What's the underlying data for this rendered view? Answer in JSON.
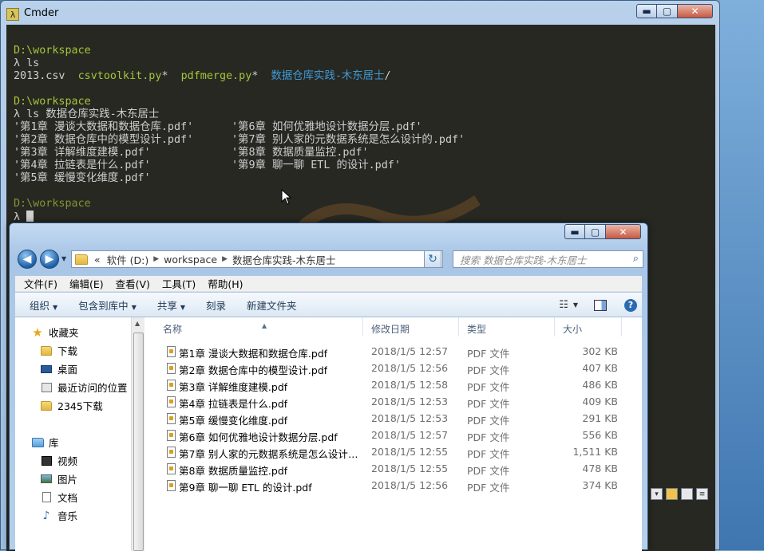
{
  "cmder": {
    "title": "Cmder",
    "app_icon": "λ",
    "window_buttons": {
      "minimize": "▬",
      "maximize": "▢",
      "close": "✕"
    },
    "terminal": {
      "blocks": [
        {
          "path": "D:\\workspace",
          "cmd": "λ ls"
        },
        {
          "path": "D:\\workspace",
          "cmd": "λ ls 数据仓库实践-木东居士"
        },
        {
          "path": "D:\\workspace",
          "cmd": "λ"
        }
      ],
      "ls_output": {
        "csv": "2013.csv",
        "py1": "csvtoolkit.py",
        "py2": "pdfmerge.py",
        "dir": "数据仓库实践-木东居士",
        "star": "*",
        "slash": "/"
      },
      "listing_rows": [
        [
          "'第1章 漫谈大数据和数据仓库.pdf'",
          "'第6章 如何优雅地设计数据分层.pdf'"
        ],
        [
          "'第2章 数据仓库中的模型设计.pdf'",
          "'第7章 别人家的元数据系统是怎么设计的.pdf'"
        ],
        [
          "'第3章 详解维度建模.pdf'",
          "'第8章 数据质量监控.pdf'"
        ],
        [
          "'第4章 拉链表是什么.pdf'",
          "'第9章 聊一聊 ETL 的设计.pdf'"
        ],
        [
          "'第5章 缓慢变化维度.pdf'",
          ""
        ]
      ]
    }
  },
  "explorer": {
    "window_buttons": {
      "minimize": "▬",
      "maximize": "▢",
      "close": "✕"
    },
    "nav": {
      "back": "◀",
      "forward": "▶",
      "dropdown": "▼"
    },
    "address": {
      "prefix": "«",
      "crumbs": [
        "软件 (D:)",
        "workspace",
        "数据仓库实践-木东居士"
      ],
      "separator": "▶",
      "dropdown": "▼"
    },
    "refresh_icon": "↻",
    "search": {
      "placeholder": "搜索 数据仓库实践-木东居士",
      "icon": "⌕"
    },
    "menubar": [
      "文件(F)",
      "编辑(E)",
      "查看(V)",
      "工具(T)",
      "帮助(H)"
    ],
    "toolbar": {
      "organize": "组织",
      "include_in_library": "包含到库中",
      "share": "共享",
      "burn": "刻录",
      "new_folder": "新建文件夹",
      "arrow": "▼",
      "view_icon": "☷",
      "help": "?"
    },
    "navpane": {
      "favorites": {
        "label": "收藏夹",
        "items": [
          "下载",
          "桌面",
          "最近访问的位置",
          "2345下载"
        ]
      },
      "libraries": {
        "label": "库",
        "items": [
          "视频",
          "图片",
          "文档",
          "音乐"
        ]
      }
    },
    "columns": {
      "name": "名称",
      "modified": "修改日期",
      "type": "类型",
      "size": "大小"
    },
    "files": [
      {
        "name": "第1章 漫谈大数据和数据仓库.pdf",
        "modified": "2018/1/5 12:57",
        "type": "PDF 文件",
        "size": "302 KB"
      },
      {
        "name": "第2章 数据仓库中的模型设计.pdf",
        "modified": "2018/1/5 12:56",
        "type": "PDF 文件",
        "size": "407 KB"
      },
      {
        "name": "第3章 详解维度建模.pdf",
        "modified": "2018/1/5 12:58",
        "type": "PDF 文件",
        "size": "486 KB"
      },
      {
        "name": "第4章 拉链表是什么.pdf",
        "modified": "2018/1/5 12:53",
        "type": "PDF 文件",
        "size": "409 KB"
      },
      {
        "name": "第5章 缓慢变化维度.pdf",
        "modified": "2018/1/5 12:53",
        "type": "PDF 文件",
        "size": "291 KB"
      },
      {
        "name": "第6章 如何优雅地设计数据分层.pdf",
        "modified": "2018/1/5 12:57",
        "type": "PDF 文件",
        "size": "556 KB"
      },
      {
        "name": "第7章 别人家的元数据系统是怎么设计的...",
        "modified": "2018/1/5 12:55",
        "type": "PDF 文件",
        "size": "1,511 KB"
      },
      {
        "name": "第8章 数据质量监控.pdf",
        "modified": "2018/1/5 12:55",
        "type": "PDF 文件",
        "size": "478 KB"
      },
      {
        "name": "第9章 聊一聊 ETL 的设计.pdf",
        "modified": "2018/1/5 12:56",
        "type": "PDF 文件",
        "size": "374 KB"
      }
    ]
  },
  "colors": {
    "terminal_bg": "#272822",
    "terminal_path": "#a6c43a",
    "terminal_dir": "#3f9ad6",
    "terminal_text": "#cfcfcf"
  }
}
